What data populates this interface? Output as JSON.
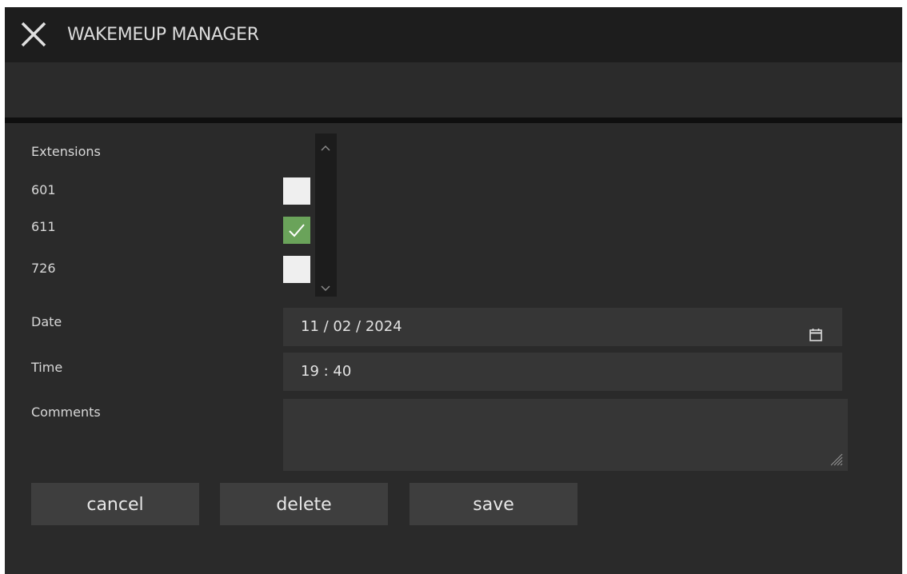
{
  "window": {
    "title": "WAKEMEUP MANAGER"
  },
  "extensions": {
    "header": "Extensions",
    "items": [
      {
        "number": "601",
        "checked": false
      },
      {
        "number": "611",
        "checked": true
      },
      {
        "number": "726",
        "checked": false
      }
    ]
  },
  "form": {
    "date_label": "Date",
    "date_value": "11 / 02 / 2024",
    "time_label": "Time",
    "time_value": "19 : 40",
    "comments_label": "Comments",
    "comments_value": ""
  },
  "buttons": {
    "cancel": "cancel",
    "delete": "delete",
    "save": "save"
  },
  "colors": {
    "checked": "#6aa35a",
    "unchecked": "#efefef",
    "background": "#2a2a2a",
    "titlebar": "#1d1d1d"
  },
  "icons": {
    "close": "close-icon",
    "calendar": "calendar-icon",
    "scroll_up": "chevron-up-icon",
    "scroll_down": "chevron-down-icon"
  }
}
